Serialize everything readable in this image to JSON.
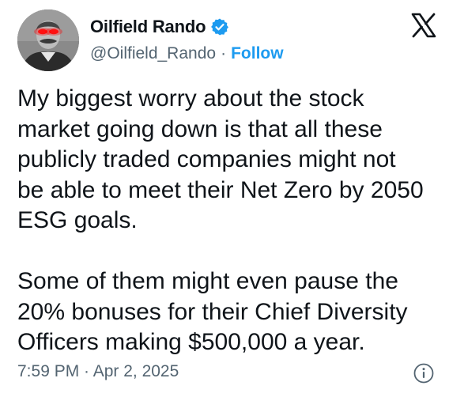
{
  "author": {
    "display_name": "Oilfield Rando",
    "handle": "@Oilfield_Rando",
    "separator": "·",
    "follow_label": "Follow",
    "verified_icon": "verified-badge-icon",
    "verified_color": "#1d9bf0"
  },
  "tweet": {
    "text": "My biggest worry about the stock\nmarket going down is that all these\npublicly traded companies might not\nbe able to meet their Net Zero by 2050\nESG goals.\n\nSome of them might even pause the\n20% bonuses for their Chief Diversity\nOfficers making $500,000 a year."
  },
  "meta": {
    "timestamp": "7:59 PM · Apr 2, 2025",
    "info_icon": "info-icon"
  },
  "platform": {
    "logo": "x-logo-icon"
  },
  "colors": {
    "text": "#0f1419",
    "secondary": "#536471",
    "accent": "#1d9bf0"
  }
}
